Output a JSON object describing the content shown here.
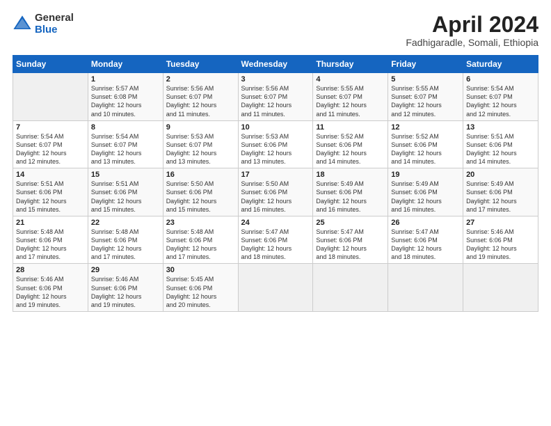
{
  "logo": {
    "general": "General",
    "blue": "Blue"
  },
  "header": {
    "title": "April 2024",
    "subtitle": "Fadhigaradle, Somali, Ethiopia"
  },
  "weekdays": [
    "Sunday",
    "Monday",
    "Tuesday",
    "Wednesday",
    "Thursday",
    "Friday",
    "Saturday"
  ],
  "weeks": [
    [
      {
        "day": "",
        "lines": []
      },
      {
        "day": "1",
        "lines": [
          "Sunrise: 5:57 AM",
          "Sunset: 6:08 PM",
          "Daylight: 12 hours",
          "and 10 minutes."
        ]
      },
      {
        "day": "2",
        "lines": [
          "Sunrise: 5:56 AM",
          "Sunset: 6:07 PM",
          "Daylight: 12 hours",
          "and 11 minutes."
        ]
      },
      {
        "day": "3",
        "lines": [
          "Sunrise: 5:56 AM",
          "Sunset: 6:07 PM",
          "Daylight: 12 hours",
          "and 11 minutes."
        ]
      },
      {
        "day": "4",
        "lines": [
          "Sunrise: 5:55 AM",
          "Sunset: 6:07 PM",
          "Daylight: 12 hours",
          "and 11 minutes."
        ]
      },
      {
        "day": "5",
        "lines": [
          "Sunrise: 5:55 AM",
          "Sunset: 6:07 PM",
          "Daylight: 12 hours",
          "and 12 minutes."
        ]
      },
      {
        "day": "6",
        "lines": [
          "Sunrise: 5:54 AM",
          "Sunset: 6:07 PM",
          "Daylight: 12 hours",
          "and 12 minutes."
        ]
      }
    ],
    [
      {
        "day": "7",
        "lines": [
          "Sunrise: 5:54 AM",
          "Sunset: 6:07 PM",
          "Daylight: 12 hours",
          "and 12 minutes."
        ]
      },
      {
        "day": "8",
        "lines": [
          "Sunrise: 5:54 AM",
          "Sunset: 6:07 PM",
          "Daylight: 12 hours",
          "and 13 minutes."
        ]
      },
      {
        "day": "9",
        "lines": [
          "Sunrise: 5:53 AM",
          "Sunset: 6:07 PM",
          "Daylight: 12 hours",
          "and 13 minutes."
        ]
      },
      {
        "day": "10",
        "lines": [
          "Sunrise: 5:53 AM",
          "Sunset: 6:06 PM",
          "Daylight: 12 hours",
          "and 13 minutes."
        ]
      },
      {
        "day": "11",
        "lines": [
          "Sunrise: 5:52 AM",
          "Sunset: 6:06 PM",
          "Daylight: 12 hours",
          "and 14 minutes."
        ]
      },
      {
        "day": "12",
        "lines": [
          "Sunrise: 5:52 AM",
          "Sunset: 6:06 PM",
          "Daylight: 12 hours",
          "and 14 minutes."
        ]
      },
      {
        "day": "13",
        "lines": [
          "Sunrise: 5:51 AM",
          "Sunset: 6:06 PM",
          "Daylight: 12 hours",
          "and 14 minutes."
        ]
      }
    ],
    [
      {
        "day": "14",
        "lines": [
          "Sunrise: 5:51 AM",
          "Sunset: 6:06 PM",
          "Daylight: 12 hours",
          "and 15 minutes."
        ]
      },
      {
        "day": "15",
        "lines": [
          "Sunrise: 5:51 AM",
          "Sunset: 6:06 PM",
          "Daylight: 12 hours",
          "and 15 minutes."
        ]
      },
      {
        "day": "16",
        "lines": [
          "Sunrise: 5:50 AM",
          "Sunset: 6:06 PM",
          "Daylight: 12 hours",
          "and 15 minutes."
        ]
      },
      {
        "day": "17",
        "lines": [
          "Sunrise: 5:50 AM",
          "Sunset: 6:06 PM",
          "Daylight: 12 hours",
          "and 16 minutes."
        ]
      },
      {
        "day": "18",
        "lines": [
          "Sunrise: 5:49 AM",
          "Sunset: 6:06 PM",
          "Daylight: 12 hours",
          "and 16 minutes."
        ]
      },
      {
        "day": "19",
        "lines": [
          "Sunrise: 5:49 AM",
          "Sunset: 6:06 PM",
          "Daylight: 12 hours",
          "and 16 minutes."
        ]
      },
      {
        "day": "20",
        "lines": [
          "Sunrise: 5:49 AM",
          "Sunset: 6:06 PM",
          "Daylight: 12 hours",
          "and 17 minutes."
        ]
      }
    ],
    [
      {
        "day": "21",
        "lines": [
          "Sunrise: 5:48 AM",
          "Sunset: 6:06 PM",
          "Daylight: 12 hours",
          "and 17 minutes."
        ]
      },
      {
        "day": "22",
        "lines": [
          "Sunrise: 5:48 AM",
          "Sunset: 6:06 PM",
          "Daylight: 12 hours",
          "and 17 minutes."
        ]
      },
      {
        "day": "23",
        "lines": [
          "Sunrise: 5:48 AM",
          "Sunset: 6:06 PM",
          "Daylight: 12 hours",
          "and 17 minutes."
        ]
      },
      {
        "day": "24",
        "lines": [
          "Sunrise: 5:47 AM",
          "Sunset: 6:06 PM",
          "Daylight: 12 hours",
          "and 18 minutes."
        ]
      },
      {
        "day": "25",
        "lines": [
          "Sunrise: 5:47 AM",
          "Sunset: 6:06 PM",
          "Daylight: 12 hours",
          "and 18 minutes."
        ]
      },
      {
        "day": "26",
        "lines": [
          "Sunrise: 5:47 AM",
          "Sunset: 6:06 PM",
          "Daylight: 12 hours",
          "and 18 minutes."
        ]
      },
      {
        "day": "27",
        "lines": [
          "Sunrise: 5:46 AM",
          "Sunset: 6:06 PM",
          "Daylight: 12 hours",
          "and 19 minutes."
        ]
      }
    ],
    [
      {
        "day": "28",
        "lines": [
          "Sunrise: 5:46 AM",
          "Sunset: 6:06 PM",
          "Daylight: 12 hours",
          "and 19 minutes."
        ]
      },
      {
        "day": "29",
        "lines": [
          "Sunrise: 5:46 AM",
          "Sunset: 6:06 PM",
          "Daylight: 12 hours",
          "and 19 minutes."
        ]
      },
      {
        "day": "30",
        "lines": [
          "Sunrise: 5:45 AM",
          "Sunset: 6:06 PM",
          "Daylight: 12 hours",
          "and 20 minutes."
        ]
      },
      {
        "day": "",
        "lines": []
      },
      {
        "day": "",
        "lines": []
      },
      {
        "day": "",
        "lines": []
      },
      {
        "day": "",
        "lines": []
      }
    ]
  ]
}
